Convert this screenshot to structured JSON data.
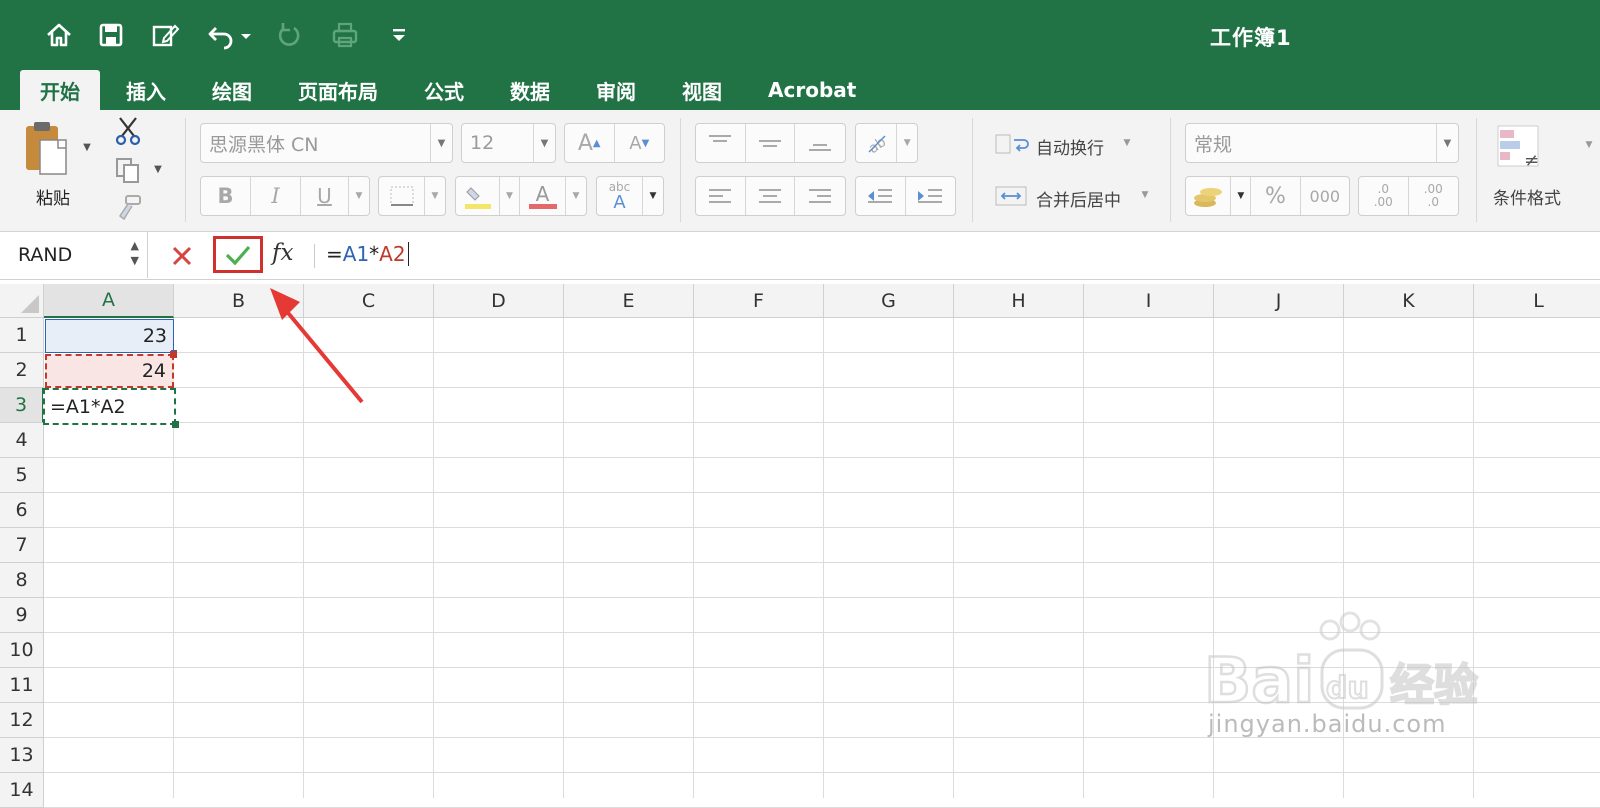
{
  "window": {
    "title": "工作簿1"
  },
  "tabs": [
    "开始",
    "插入",
    "绘图",
    "页面布局",
    "公式",
    "数据",
    "审阅",
    "视图",
    "Acrobat"
  ],
  "ribbon": {
    "paste_label": "粘贴",
    "font_name": "思源黑体 CN",
    "font_size": "12",
    "grow_font": "A",
    "shrink_font": "A",
    "bold": "B",
    "italic": "I",
    "underline": "U",
    "font_color": "A",
    "phonetic": "abc",
    "phonetic_a": "A",
    "wrap_text": "自动换行",
    "merge_center": "合并后居中",
    "number_format": "常规",
    "percent": "%",
    "thousands": "000",
    "inc_decimal": ".0",
    "inc_decimal_b": ".00",
    "dec_decimal": ".00",
    "dec_decimal_b": ".0",
    "conditional_format": "条件格式"
  },
  "formula_bar": {
    "name_box": "RAND",
    "fx": "fx",
    "formula_eq": "=",
    "formula_ref1": "A1",
    "formula_op": "*",
    "formula_ref2": "A2"
  },
  "sheet": {
    "columns": [
      "A",
      "B",
      "C",
      "D",
      "E",
      "F",
      "G",
      "H",
      "I",
      "J",
      "K",
      "L"
    ],
    "rows": [
      "1",
      "2",
      "3",
      "4",
      "5",
      "6",
      "7",
      "8",
      "9",
      "10",
      "11",
      "12",
      "13",
      "14"
    ],
    "cells": {
      "A1": "23",
      "A2": "24",
      "A3": "=A1*A2"
    }
  },
  "watermark": {
    "brand": "Bai du 经验",
    "url": "jingyan.baidu.com"
  },
  "colors": {
    "excel_green": "#217346",
    "ref_blue": "#2e64b4",
    "ref_red": "#c0392b",
    "highlight_red": "#d0312d"
  }
}
